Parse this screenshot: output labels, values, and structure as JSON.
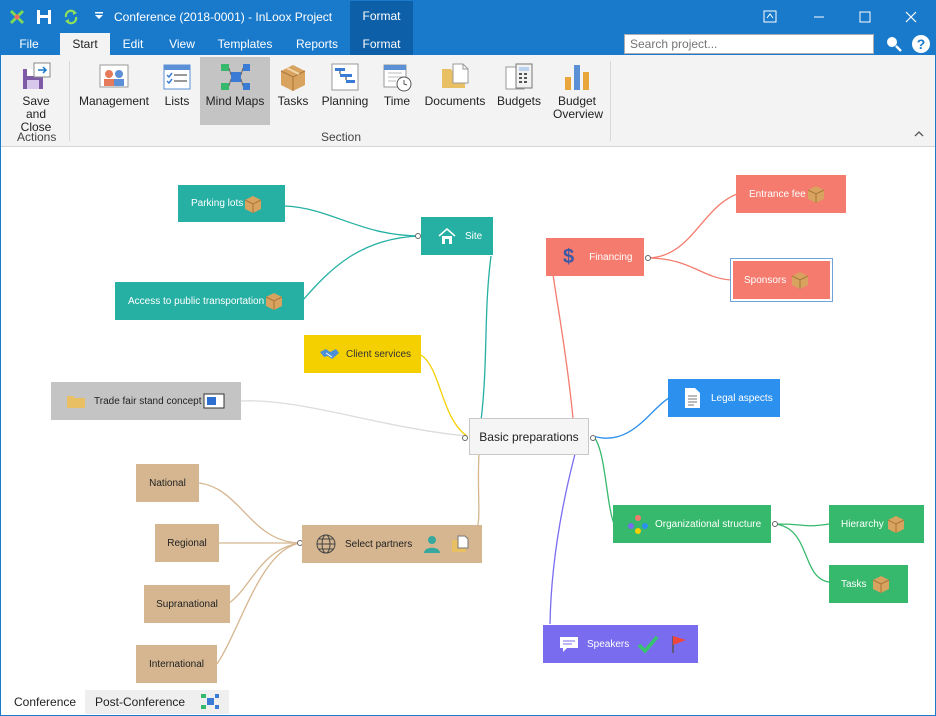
{
  "titlebar": {
    "title": "Conference (2018-0001) - InLoox Project",
    "context_tab": "Format"
  },
  "tabs": [
    "File",
    "Start",
    "Edit",
    "View",
    "Templates",
    "Reports",
    "Format"
  ],
  "search": {
    "placeholder": "Search project..."
  },
  "ribbon": {
    "save_close": "Save and Close",
    "buttons": [
      "Management",
      "Lists",
      "Mind Maps",
      "Tasks",
      "Planning",
      "Time",
      "Documents",
      "Budgets",
      "Budget Overview"
    ],
    "groups": {
      "actions": "Actions",
      "section": "Section"
    }
  },
  "mindmap": {
    "root": "Basic preparations",
    "nodes": {
      "site": "Site",
      "parking": "Parking lots",
      "transport": "Access to public transportation",
      "client": "Client services",
      "trade": "Trade fair stand concept",
      "partners": "Select partners",
      "national": "National",
      "regional": "Regional",
      "supranational": "Supranational",
      "international": "International",
      "financing": "Financing",
      "entrance": "Entrance fee",
      "sponsors": "Sponsors",
      "legal": "Legal aspects",
      "org": "Organizational structure",
      "hierarchy": "Hierarchy",
      "tasks": "Tasks",
      "speakers": "Speakers"
    },
    "colors": {
      "teal": "#26b0a3",
      "yellow": "#f5d000",
      "grey": "#c4c4c4",
      "tan": "#d5b690",
      "salmon": "#f47b6d",
      "blue": "#2c90ee",
      "green": "#36b96c",
      "purple": "#7a6cef"
    }
  },
  "bottom_tabs": [
    "Conference",
    "Post-Conference"
  ]
}
